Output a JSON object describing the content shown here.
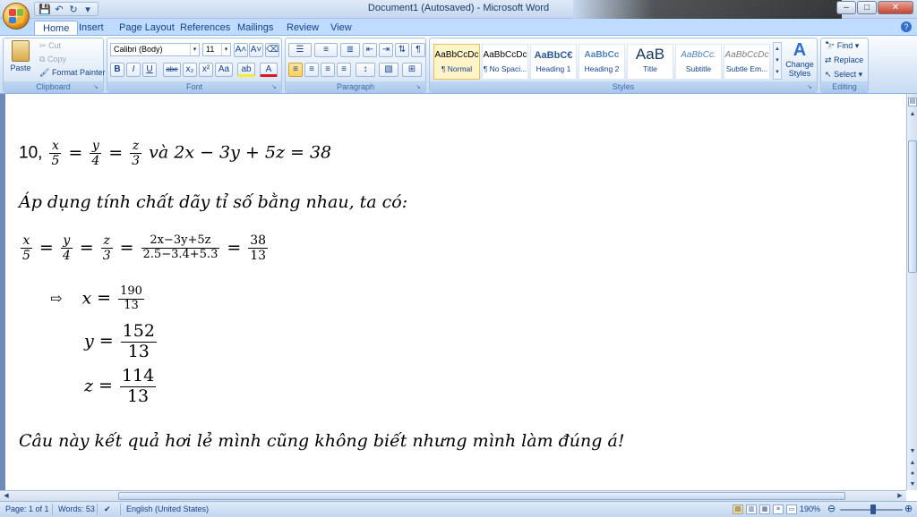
{
  "window": {
    "title": "Document1 (Autosaved) - Microsoft Word",
    "min": "–",
    "max": "□",
    "close": "✕"
  },
  "qat": {
    "save": "💾",
    "undo": "↶",
    "redo": "↻",
    "more": "▾"
  },
  "tabs": [
    "Home",
    "Insert",
    "Page Layout",
    "References",
    "Mailings",
    "Review",
    "View"
  ],
  "help": "?",
  "ribbon": {
    "clipboard": {
      "label": "Clipboard",
      "paste": "Paste",
      "cut": "Cut",
      "copy": "Copy",
      "format_painter": "Format Painter"
    },
    "font": {
      "label": "Font",
      "font_name": "Calibri (Body)",
      "font_size": "11",
      "grow": "A˄",
      "shrink": "A˅",
      "clear": "🧹",
      "bold": "B",
      "italic": "I",
      "underline": "U",
      "strike": "abe",
      "subscript": "x₂",
      "superscript": "x²",
      "change_case": "Aa",
      "highlight": "ab",
      "font_color": "A"
    },
    "paragraph": {
      "label": "Paragraph",
      "bullets": "☰",
      "numbering": "≡",
      "multilevel": "≣",
      "decrease_indent": "⇤",
      "increase_indent": "⇥",
      "sort": "⇅",
      "show_marks": "¶",
      "align_left": "≡",
      "center": "≡",
      "align_right": "≡",
      "justify": "≡",
      "line_spacing": "↕",
      "shading": "▧",
      "borders": "⊞"
    },
    "styles": {
      "label": "Styles",
      "items": [
        {
          "sample": "AaBbCcDc",
          "name": "¶ Normal"
        },
        {
          "sample": "AaBbCcDc",
          "name": "¶ No Spaci..."
        },
        {
          "sample": "AaBbC€",
          "name": "Heading 1"
        },
        {
          "sample": "AaBbCc",
          "name": "Heading 2"
        },
        {
          "sample": "AaB",
          "name": "Title"
        },
        {
          "sample": "AaBbCc.",
          "name": "Subtitle"
        },
        {
          "sample": "AaBbCcDc",
          "name": "Subtle Em..."
        }
      ],
      "change_styles": "Change Styles"
    },
    "editing": {
      "label": "Editing",
      "find": "Find",
      "replace": "Replace",
      "select": "Select"
    }
  },
  "document": {
    "problem_number": "10,",
    "p1": {
      "x": "x",
      "five": "5",
      "y": "y",
      "four": "4",
      "z": "z",
      "three": "3",
      "va": "và",
      "expr": "2x − 3y + 5z = 38"
    },
    "line2": "Áp dụng tính chất dãy tỉ số bằng nhau, ta có:",
    "p3": {
      "x": "x",
      "five": "5",
      "y": "y",
      "four": "4",
      "z": "z",
      "three": "3",
      "big_num": "2x−3y+5z",
      "big_den": "2.5−3.4+5.3",
      "res_num": "38",
      "res_den": "13"
    },
    "arrow": "⇨",
    "sol_x": {
      "var": "x",
      "num": "190",
      "den": "13"
    },
    "sol_y": {
      "var": "y",
      "num": "152",
      "den": "13"
    },
    "sol_z": {
      "var": "z",
      "num": "114",
      "den": "13"
    },
    "closing": "Câu này kết quả hơi lẻ mình cũng không biết nhưng mình làm đúng á!"
  },
  "status": {
    "page": "Page: 1 of 1",
    "words": "Words: 53",
    "language": "English (United States)",
    "zoom": "190%"
  }
}
